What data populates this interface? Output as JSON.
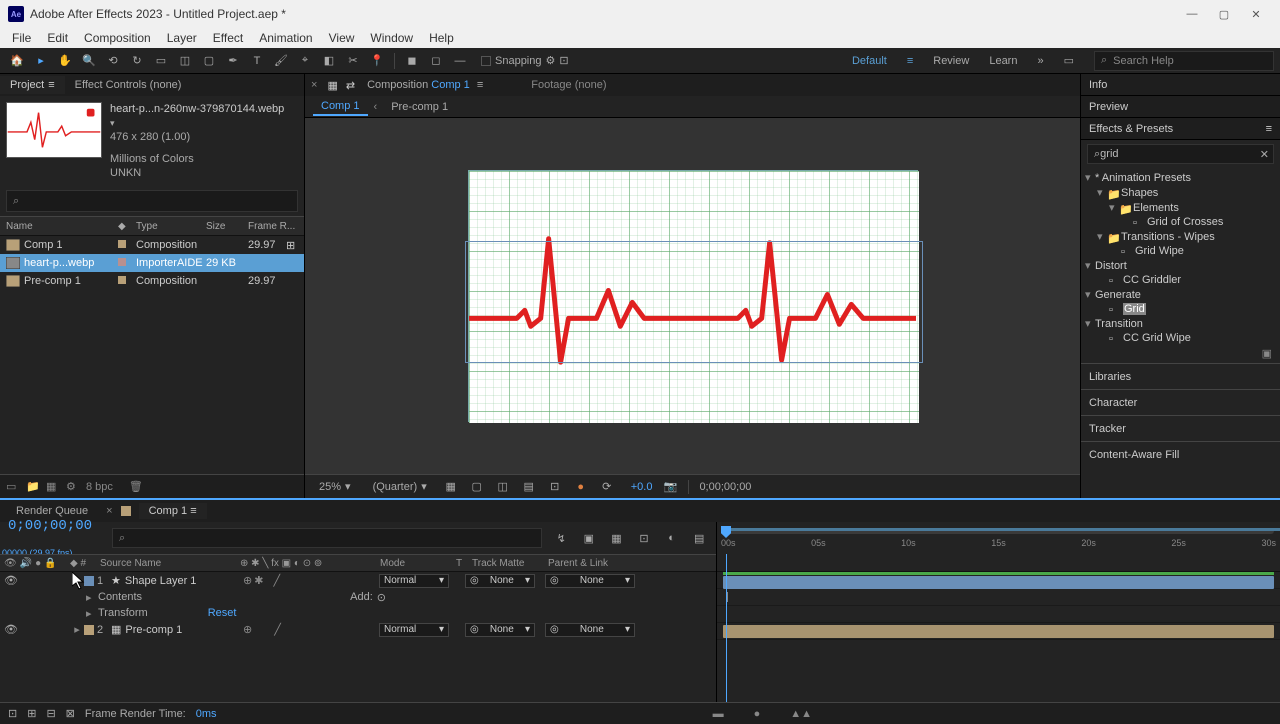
{
  "titlebar": {
    "title": "Adobe After Effects 2023 - Untitled Project.aep *"
  },
  "menu": [
    "File",
    "Edit",
    "Composition",
    "Layer",
    "Effect",
    "Animation",
    "View",
    "Window",
    "Help"
  ],
  "toolbar": {
    "snapping_label": "Snapping",
    "ws": {
      "default": "Default",
      "review": "Review",
      "learn": "Learn"
    },
    "search_placeholder": "Search Help"
  },
  "panels": {
    "project_tab": "Project",
    "effect_controls": "Effect Controls  (none)",
    "thumb": {
      "name": "heart-p...n-260nw-379870144.webp",
      "dims": "476 x 280 (1.00)",
      "colors": "Millions of Colors",
      "codec": "UNKN"
    },
    "headers": {
      "name": "Name",
      "type": "Type",
      "size": "Size",
      "fr": "Frame R..."
    },
    "items": [
      {
        "name": "Comp 1",
        "type": "Composition",
        "size": "",
        "fr": "29.97",
        "icon": "comp"
      },
      {
        "name": "heart-p...webp",
        "type": "ImporterAIDE",
        "size": "29 KB",
        "fr": "",
        "icon": "img",
        "sel": true
      },
      {
        "name": "Pre-comp 1",
        "type": "Composition",
        "size": "",
        "fr": "29.97",
        "icon": "comp"
      }
    ],
    "bpc": "8 bpc"
  },
  "comp": {
    "panel_label": "Composition",
    "comp_name": "Comp 1",
    "footage_label": "Footage  (none)",
    "breadcrumb": {
      "active": "Comp 1",
      "next": "Pre-comp 1"
    },
    "zoom": "25%",
    "res": "(Quarter)",
    "time_offset": "+0.0",
    "timecode": "0;00;00;00"
  },
  "right": {
    "info": "Info",
    "preview": "Preview",
    "ep_title": "Effects & Presets",
    "search_value": "grid",
    "tree": {
      "anim_presets": "* Animation Presets",
      "shapes": "Shapes",
      "elements": "Elements",
      "grid_crosses": "Grid of Crosses",
      "trans_wipes": "Transitions - Wipes",
      "grid_wipe": "Grid Wipe",
      "distort": "Distort",
      "cc_griddler": "CC Griddler",
      "generate": "Generate",
      "grid": "Grid",
      "transition": "Transition",
      "cc_grid_wipe": "CC Grid Wipe"
    },
    "libraries": "Libraries",
    "character": "Character",
    "tracker": "Tracker",
    "caf": "Content-Aware Fill"
  },
  "timeline": {
    "rq_tab": "Render Queue",
    "comp_tab": "Comp 1",
    "timecode": "0;00;00;00",
    "fps_label": "00000 (29.97 fps)",
    "headers": {
      "src": "Source Name",
      "mode": "Mode",
      "t": "T",
      "tm": "Track Matte",
      "pl": "Parent & Link"
    },
    "ticks": [
      "00s",
      "05s",
      "10s",
      "15s",
      "20s",
      "25s",
      "30s"
    ],
    "layer1": {
      "num": "1",
      "name": "Shape Layer 1",
      "mode": "Normal",
      "tm": "None",
      "pl": "None"
    },
    "contents": "Contents",
    "add_label": "Add:",
    "transform": "Transform",
    "reset": "Reset",
    "layer2": {
      "num": "2",
      "name": "Pre-comp 1",
      "mode": "Normal",
      "tm": "None",
      "pl": "None"
    }
  },
  "status": {
    "frt_label": "Frame Render Time:",
    "frt_val": "0ms"
  }
}
